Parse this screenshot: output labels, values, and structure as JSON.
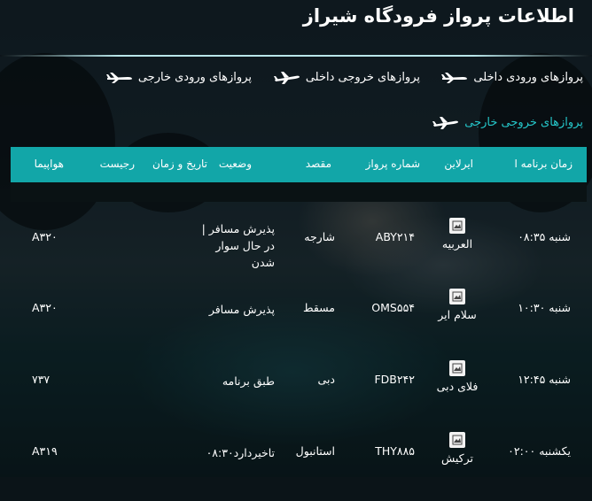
{
  "page": {
    "title": "اطلاعات پرواز فرودگاه شیراز"
  },
  "tabs": [
    {
      "label": "پروازهای ورودی داخلی",
      "active": false
    },
    {
      "label": "پروازهای خروجی داخلی",
      "active": false
    },
    {
      "label": "پروازهای ورودی خارجی",
      "active": false
    },
    {
      "label": "پروازهای خروجی خارجی",
      "active": true
    }
  ],
  "table": {
    "columns": [
      "زمان برنامه ا",
      "ایرلاین",
      "شماره پرواز",
      "مقصد",
      "وضعیت",
      "تاریخ و زمان",
      "رجیست",
      "هواپیما"
    ],
    "rows": [
      {
        "time": "شنبه ۰۸:۳۵",
        "airline": "العربیه",
        "flight": "ABY۲۱۴",
        "destination": "شارجه",
        "status": "پذیرش مسافر | در حال سوار شدن",
        "aircraft": "A۳۲۰"
      },
      {
        "time": "شنبه ۱۰:۳۰",
        "airline": "سلام ایر",
        "flight": "OMS۵۵۴",
        "destination": "مسقط",
        "status": "پذیرش مسافر",
        "aircraft": "A۳۲۰"
      },
      {
        "time": "شنبه ۱۲:۴۵",
        "airline": "فلای دبی",
        "flight": "FDB۲۴۲",
        "destination": "دبی",
        "status": "طبق برنامه",
        "aircraft": "۷۳۷"
      },
      {
        "time": "یکشنبه ۰۲:۰۰",
        "airline": "ترکیش",
        "flight": "THY۸۸۵",
        "destination": "استانبول",
        "status": "تاخیردارد۰۸:۳۰",
        "aircraft": "A۳۱۹"
      }
    ]
  },
  "colors": {
    "accent": "#12a6a8",
    "active_tab": "#25c6c9"
  }
}
